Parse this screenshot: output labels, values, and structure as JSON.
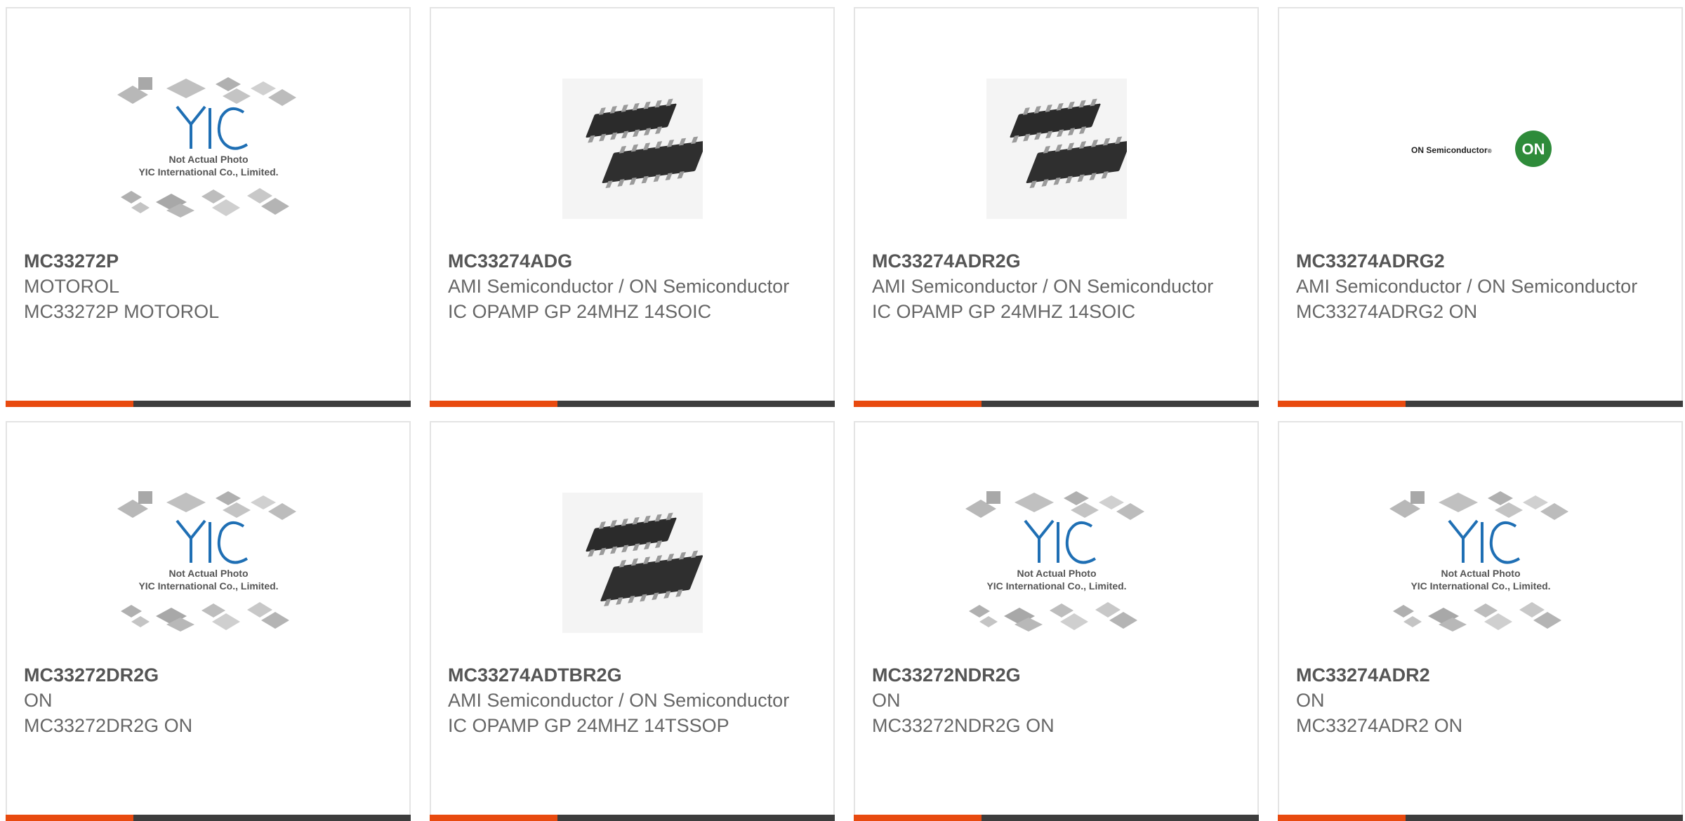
{
  "colors": {
    "accent": "#e84a0f",
    "bar": "#3d3d3d",
    "text": "#666666",
    "yic_blue": "#1f6fb4",
    "on_green": "#2e8b3a"
  },
  "placeholder": {
    "line1": "Not Actual Photo",
    "line2": "YIC International Co., Limited.",
    "brand": "YIC"
  },
  "onlogo": {
    "text": "ON Semiconductor",
    "badge": "ON"
  },
  "products": [
    {
      "pn": "MC33272P",
      "mfr": "MOTOROL",
      "desc": "MC33272P MOTOROL",
      "image": "placeholder"
    },
    {
      "pn": "MC33274ADG",
      "mfr": "AMI Semiconductor / ON Semiconductor",
      "desc": "IC OPAMP GP 24MHZ 14SOIC",
      "image": "soic-chip"
    },
    {
      "pn": "MC33274ADR2G",
      "mfr": "AMI Semiconductor / ON Semiconductor",
      "desc": "IC OPAMP GP 24MHZ 14SOIC",
      "image": "soic-chip"
    },
    {
      "pn": "MC33274ADRG2",
      "mfr": "AMI Semiconductor / ON Semiconductor",
      "desc": "MC33274ADRG2 ON",
      "image": "on-logo"
    },
    {
      "pn": "MC33272DR2G",
      "mfr": "ON",
      "desc": "MC33272DR2G ON",
      "image": "placeholder"
    },
    {
      "pn": "MC33274ADTBR2G",
      "mfr": "AMI Semiconductor / ON Semiconductor",
      "desc": "IC OPAMP GP 24MHZ 14TSSOP",
      "image": "tssop-chip"
    },
    {
      "pn": "MC33272NDR2G",
      "mfr": "ON",
      "desc": "MC33272NDR2G ON",
      "image": "placeholder"
    },
    {
      "pn": "MC33274ADR2",
      "mfr": "ON",
      "desc": "MC33274ADR2 ON",
      "image": "placeholder"
    }
  ]
}
